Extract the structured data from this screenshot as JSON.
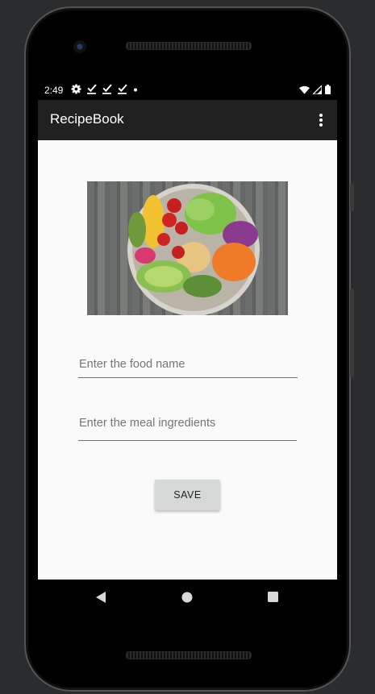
{
  "status_bar": {
    "time": "2:49",
    "left_icons": [
      "gear-icon",
      "check-download-icon",
      "check-download-icon",
      "check-download-icon",
      "dot-icon"
    ],
    "right_icons": [
      "wifi-icon",
      "signal-icon",
      "battery-icon"
    ]
  },
  "app_bar": {
    "title": "RecipeBook",
    "menu_icon": "more-vert-icon"
  },
  "form": {
    "image_description_icon": "food-bowl-image",
    "food_name_placeholder": "Enter the food name",
    "ingredients_placeholder": "Enter the meal ingredients",
    "save_label": "SAVE"
  },
  "navigation": {
    "back_icon": "back-icon",
    "home_icon": "home-icon",
    "recents_icon": "recents-icon"
  },
  "colors": {
    "app_bar": "#212121",
    "background": "#fafafa",
    "button": "#d6d7d7"
  }
}
